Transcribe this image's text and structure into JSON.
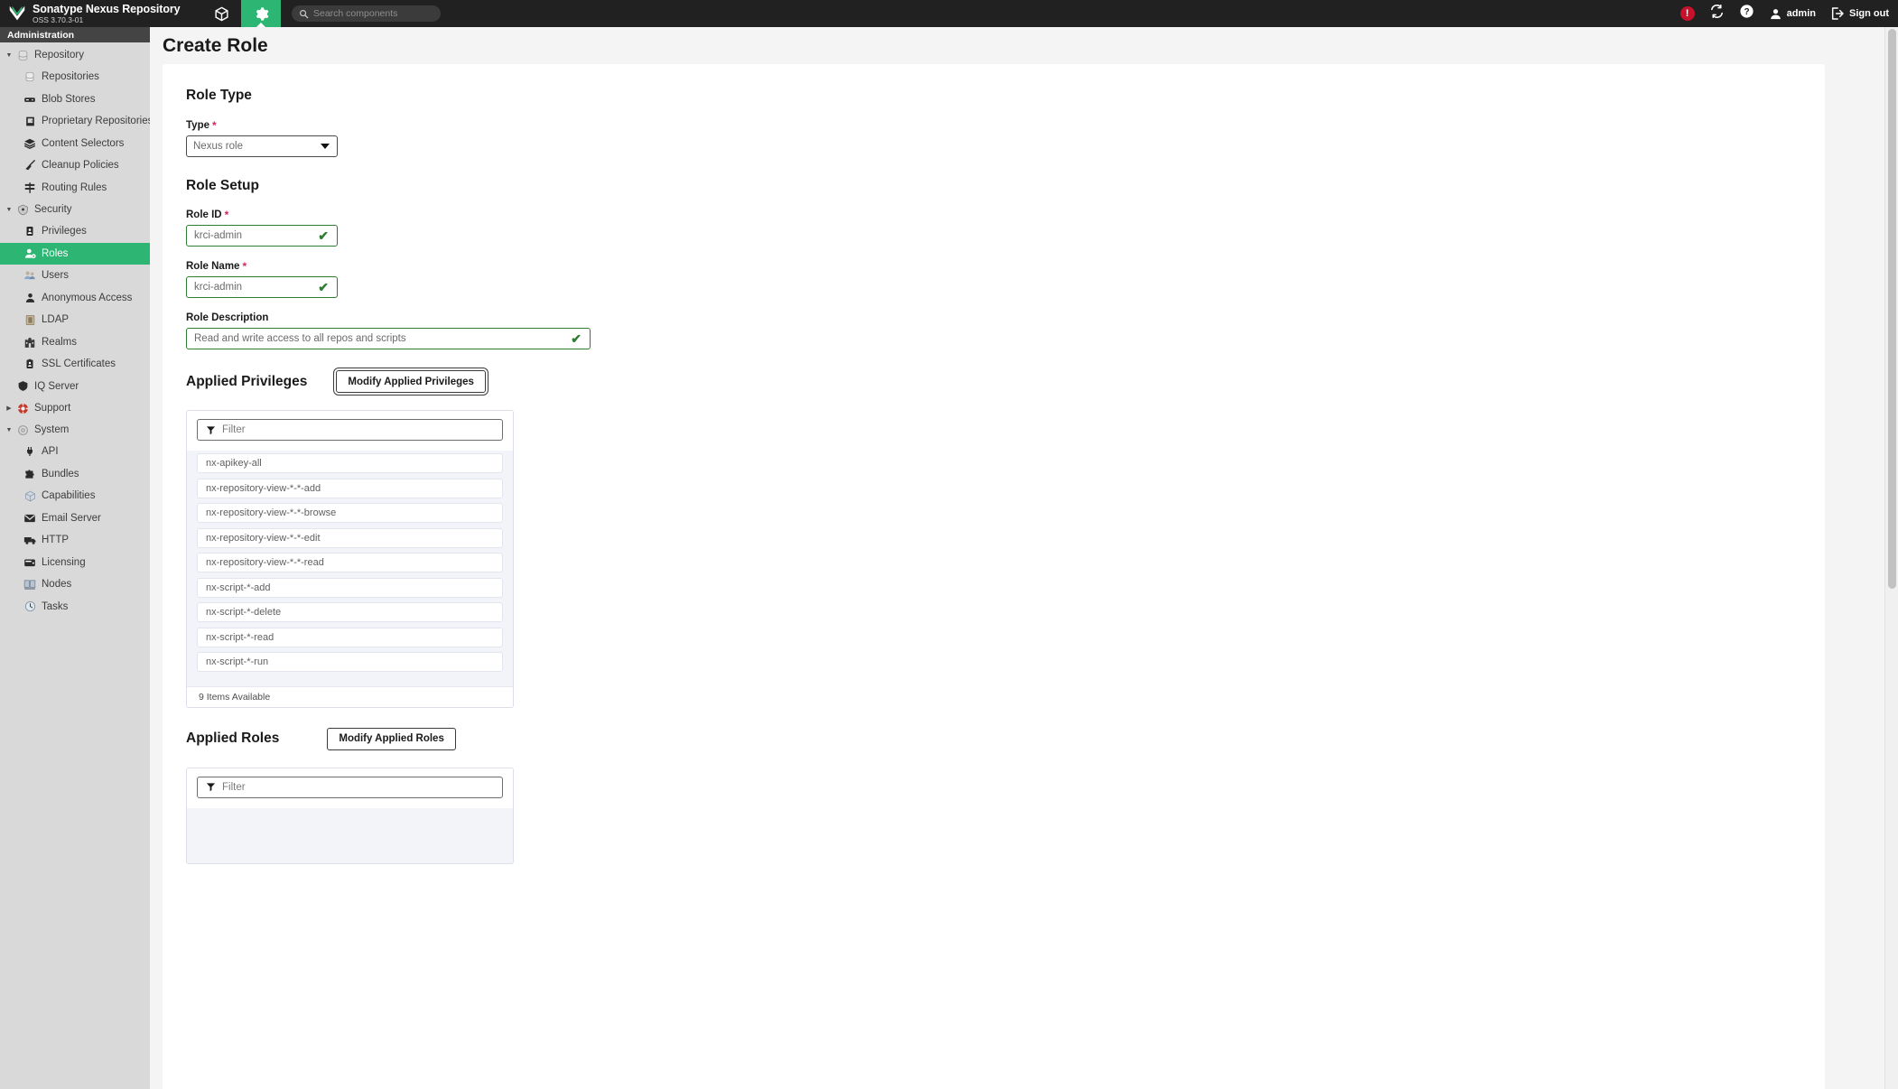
{
  "header": {
    "brand_title": "Sonatype Nexus Repository",
    "brand_subtitle": "OSS 3.70.3-01",
    "browse_icon": "cube-icon",
    "admin_icon": "gear-icon",
    "search_placeholder": "Search components",
    "search_icon": "search-icon",
    "error_badge": "!",
    "error_icon": "alert-circle-icon",
    "refresh_icon": "sync-icon",
    "help_icon": "question-circle-icon",
    "user_icon": "user-icon",
    "user_label": "admin",
    "signout_icon": "sign-out-icon",
    "signout_label": "Sign out"
  },
  "sidebar": {
    "section_label": "Administration",
    "groups": [
      {
        "label": "Repository",
        "icon": "database-icon",
        "expanded": true,
        "caret": "▼",
        "items": [
          {
            "label": "Repositories",
            "icon": "database-icon"
          },
          {
            "label": "Blob Stores",
            "icon": "blobstore-icon"
          },
          {
            "label": "Proprietary Repositories",
            "icon": "door-icon"
          },
          {
            "label": "Content Selectors",
            "icon": "layers-icon"
          },
          {
            "label": "Cleanup Policies",
            "icon": "broom-icon"
          },
          {
            "label": "Routing Rules",
            "icon": "signpost-icon"
          }
        ]
      },
      {
        "label": "Security",
        "icon": "shield-lock-icon",
        "expanded": true,
        "caret": "▼",
        "items": [
          {
            "label": "Privileges",
            "icon": "id-badge-icon"
          },
          {
            "label": "Roles",
            "icon": "user-gear-icon",
            "selected": true
          },
          {
            "label": "Users",
            "icon": "users-icon"
          },
          {
            "label": "Anonymous Access",
            "icon": "user-icon"
          },
          {
            "label": "LDAP",
            "icon": "book-icon"
          },
          {
            "label": "Realms",
            "icon": "castle-icon"
          },
          {
            "label": "SSL Certificates",
            "icon": "certificate-icon"
          }
        ]
      }
    ],
    "standalone": [
      {
        "label": "IQ Server",
        "icon": "shield-icon",
        "caret": ""
      },
      {
        "label": "Support",
        "icon": "lifering-icon",
        "caret": "▶"
      }
    ],
    "system_group": {
      "label": "System",
      "icon": "gear-icon",
      "caret": "▼",
      "items": [
        {
          "label": "API",
          "icon": "plug-icon"
        },
        {
          "label": "Bundles",
          "icon": "puzzle-icon"
        },
        {
          "label": "Capabilities",
          "icon": "box-icon"
        },
        {
          "label": "Email Server",
          "icon": "envelope-icon"
        },
        {
          "label": "HTTP",
          "icon": "truck-icon"
        },
        {
          "label": "Licensing",
          "icon": "wallet-icon"
        },
        {
          "label": "Nodes",
          "icon": "nodes-icon"
        },
        {
          "label": "Tasks",
          "icon": "clock-icon"
        }
      ]
    }
  },
  "page": {
    "title": "Create Role",
    "sections": {
      "role_type": {
        "heading": "Role Type",
        "type_label": "Type",
        "type_required": "*",
        "type_value": "Nexus role",
        "dropdown_icon": "chevron-down-icon"
      },
      "role_setup": {
        "heading": "Role Setup",
        "role_id_label": "Role ID",
        "role_id_required": "*",
        "role_id_value": "krci-admin",
        "role_name_label": "Role Name",
        "role_name_required": "*",
        "role_name_value": "krci-admin",
        "role_description_label": "Role Description",
        "role_description_value": "Read and write access to all repos and scripts",
        "valid_icon": "check-icon",
        "valid_glyph": "✔"
      },
      "applied_privileges": {
        "heading": "Applied Privileges",
        "modify_button": "Modify Applied Privileges",
        "filter_placeholder": "Filter",
        "filter_icon": "funnel-icon",
        "items": [
          "nx-apikey-all",
          "nx-repository-view-*-*-add",
          "nx-repository-view-*-*-browse",
          "nx-repository-view-*-*-edit",
          "nx-repository-view-*-*-read",
          "nx-script-*-add",
          "nx-script-*-delete",
          "nx-script-*-read",
          "nx-script-*-run"
        ],
        "footer": "9 Items Available"
      },
      "applied_roles": {
        "heading": "Applied Roles",
        "modify_button": "Modify Applied Roles",
        "filter_placeholder": "Filter",
        "filter_icon": "funnel-icon",
        "items": []
      }
    }
  },
  "colors": {
    "accent_green": "#2db673",
    "topbar_dark": "#212121",
    "admin_bar": "#444444",
    "sidebar_bg": "#d9d9d9",
    "required_red": "#d6255b",
    "error_red": "#c8112b",
    "valid_green": "#2e7d32"
  }
}
